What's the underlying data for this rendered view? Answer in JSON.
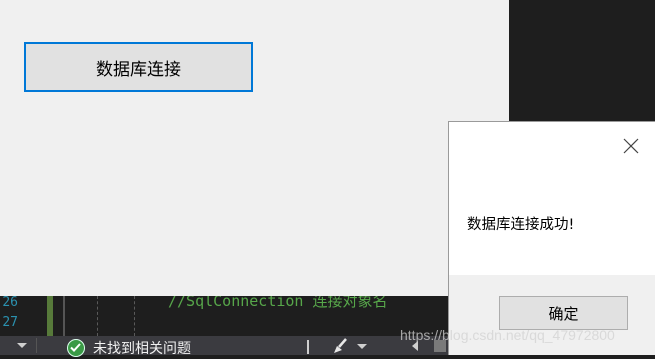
{
  "form": {
    "connect_button_label": "数据库连接"
  },
  "editor": {
    "line_numbers": [
      "26",
      "27"
    ],
    "comment_text": "//SqlConnection 连接对象名"
  },
  "status_bar": {
    "issues_text": "未找到相关问题",
    "issues_icon": "check-circle-icon"
  },
  "message_box": {
    "message": "数据库连接成功!",
    "ok_label": "确定",
    "close_icon": "close-icon"
  },
  "watermark": {
    "text": "https://blog.csdn.net/qq_47972800"
  },
  "colors": {
    "focus_border": "#0078d7",
    "form_background": "#f0f0f0",
    "ide_background": "#1e1e1e",
    "status_bar": "#3b3b40",
    "check_green": "#3a9a46"
  }
}
